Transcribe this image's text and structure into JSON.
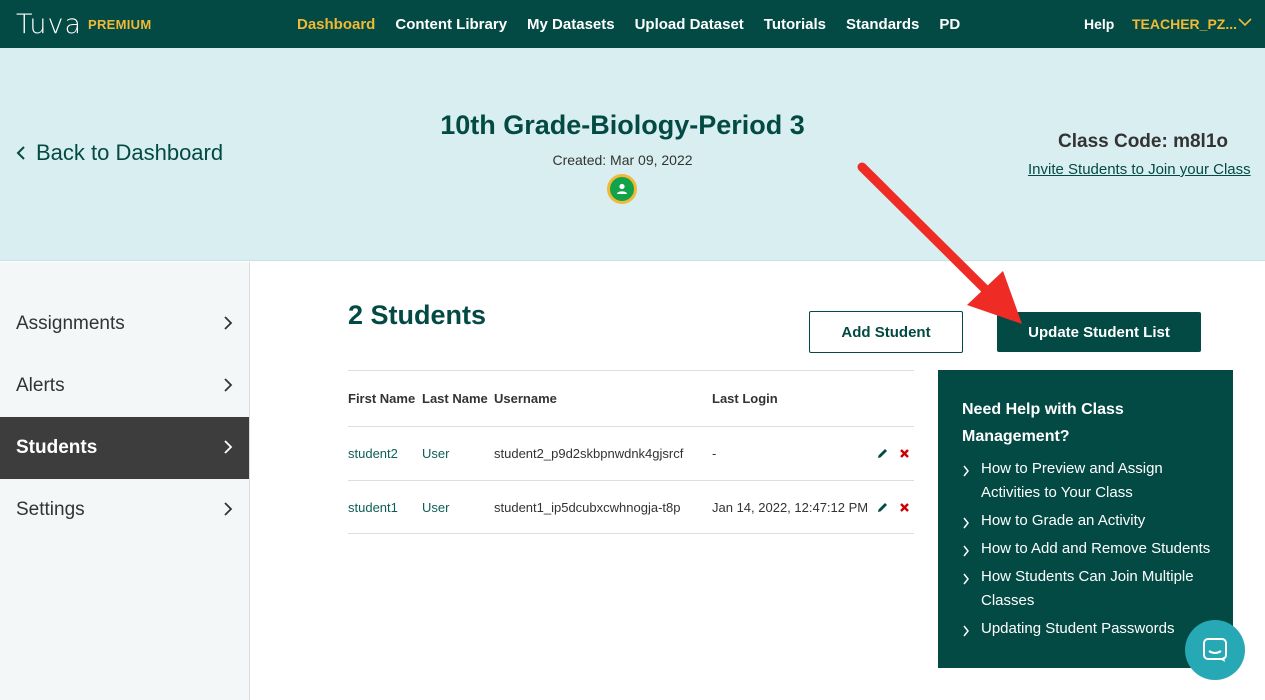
{
  "brand": {
    "logo": "Tuva",
    "badge": "PREMIUM"
  },
  "nav": {
    "links": [
      "Dashboard",
      "Content Library",
      "My Datasets",
      "Upload Dataset",
      "Tutorials",
      "Standards",
      "PD"
    ],
    "help": "Help",
    "user": "TEACHER_PZ..."
  },
  "header": {
    "back": "Back to Dashboard",
    "class_title": "10th Grade-Biology-Period 3",
    "created": "Created: Mar 09, 2022",
    "class_code": "Class Code: m8l1o",
    "invite": "Invite Students to Join your Class"
  },
  "sidebar": {
    "items": [
      {
        "label": "Assignments"
      },
      {
        "label": "Alerts"
      },
      {
        "label": "Students"
      },
      {
        "label": "Settings"
      }
    ]
  },
  "main": {
    "title": "2 Students",
    "add_button": "Add Student",
    "update_button": "Update Student List",
    "columns": [
      "First Name",
      "Last Name",
      "Username",
      "Last Login"
    ],
    "rows": [
      {
        "first": "student2",
        "last": "User",
        "username": "student2_p9d2skbpnwdnk4gjsrcf",
        "login": "-"
      },
      {
        "first": "student1",
        "last": "User",
        "username": "student1_ip5dcubxcwhnogja-t8p",
        "login": "Jan 14, 2022, 12:47:12 PM"
      }
    ]
  },
  "helpbox": {
    "title": "Need Help with Class Management?",
    "items": [
      "How to Preview and Assign Activities to Your Class",
      "How to Grade an Activity",
      "How to Add and Remove Students",
      "How Students Can Join Multiple Classes",
      "Updating Student Passwords"
    ]
  },
  "colors": {
    "brand_dark": "#034a44",
    "accent_yellow": "#f1b935",
    "band": "#d9eef0",
    "delete_red": "#cc0000",
    "chat": "#27a8b5"
  }
}
